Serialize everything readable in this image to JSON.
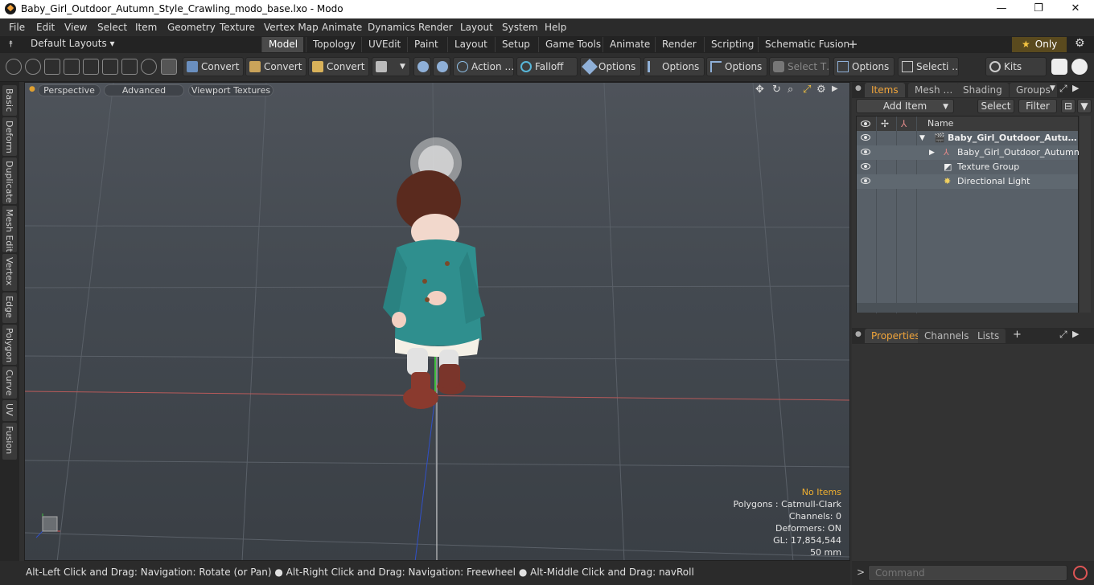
{
  "window": {
    "title": "Baby_Girl_Outdoor_Autumn_Style_Crawling_modo_base.lxo - Modo",
    "minimize": "—",
    "maximize": "❐",
    "close": "✕"
  },
  "menu": [
    "File",
    "Edit",
    "View",
    "Select",
    "Item",
    "Geometry",
    "Texture",
    "Vertex Map",
    "Animate",
    "Dynamics",
    "Render",
    "Layout",
    "System",
    "Help"
  ],
  "layouts": {
    "label": "Default Layouts ▾",
    "tabs": [
      "Model",
      "Topology",
      "UVEdit",
      "Paint",
      "Layout",
      "Setup",
      "Game Tools",
      "Animate",
      "Render",
      "Scripting",
      "Schematic Fusion"
    ],
    "active": "Model",
    "add": "+",
    "only": "Only",
    "star": "★",
    "gear": "⚙"
  },
  "toolbar": {
    "convert1": "Convert",
    "convert2": "Convert",
    "convert3": "Convert",
    "action": "Action …",
    "falloff": "Falloff",
    "options1": "Options",
    "options2": "Options",
    "options3": "Options",
    "select_t": "Select T…",
    "options4": "Options",
    "selecti": "Selecti …",
    "kits": "Kits"
  },
  "lefttabs": [
    "Basic",
    "Deform",
    "Duplicate",
    "Mesh Edit",
    "Vertex",
    "Edge",
    "Polygon",
    "Curve",
    "UV",
    "Fusion"
  ],
  "viewport": {
    "perspective": "Perspective",
    "advanced": "Advanced",
    "textures": "Viewport Textures",
    "hud": {
      "no_items": "No Items",
      "polygons": "Polygons : Catmull-Clark",
      "channels": "Channels: 0",
      "deformers": "Deformers: ON",
      "gl": "GL: 17,854,544",
      "size": "50 mm"
    }
  },
  "items_panel": {
    "tabs": [
      "Items",
      "Mesh …",
      "Shading",
      "Groups"
    ],
    "add_item": "Add Item",
    "select": "Select",
    "filter": "Filter",
    "col_name": "Name",
    "rows": [
      {
        "name": "Baby_Girl_Outdoor_Autu…",
        "bold": true
      },
      {
        "name": "Baby_Girl_Outdoor_Autumn …",
        "bold": false
      },
      {
        "name": "Texture Group",
        "bold": false
      },
      {
        "name": "Directional Light",
        "bold": false
      }
    ]
  },
  "properties_panel": {
    "tabs": [
      "Properties",
      "Channels",
      "Lists"
    ],
    "add": "+"
  },
  "status": {
    "text": "Alt-Left Click and Drag: Navigation: Rotate (or Pan) ● Alt-Right Click and Drag: Navigation: Freewheel ● Alt-Middle Click and Drag: navRoll"
  },
  "command": {
    "placeholder": "Command",
    "arrow": ">"
  },
  "colors": {
    "accent": "#f0a43a",
    "coat": "#2f8f8e",
    "hat": "#5a2a1e",
    "boots": "#8a3a2e"
  }
}
